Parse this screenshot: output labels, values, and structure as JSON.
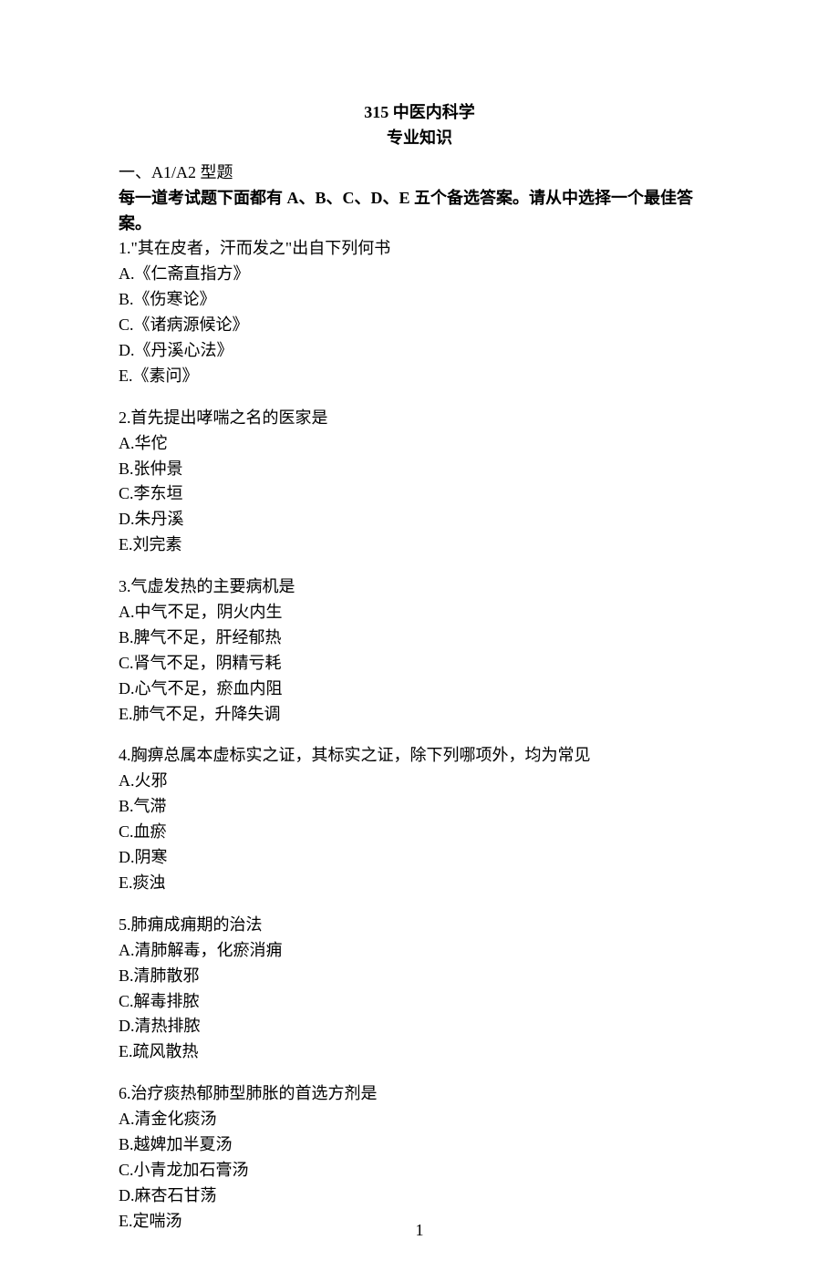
{
  "title": "315 中医内科学",
  "subtitle": "专业知识",
  "section_heading": "一、A1/A2 型题",
  "instructions": "每一道考试题下面都有 A、B、C、D、E 五个备选答案。请从中选择一个最佳答案。",
  "questions": [
    {
      "number": "1.",
      "stem": "\"其在皮者，汗而发之\"出自下列何书",
      "options": [
        "A.《仁斋直指方》",
        "B.《伤寒论》",
        "C.《诸病源候论》",
        "D.《丹溪心法》",
        "E.《素问》"
      ]
    },
    {
      "number": "2.",
      "stem": "首先提出哮喘之名的医家是",
      "options": [
        "A.华佗",
        "B.张仲景",
        "C.李东垣",
        "D.朱丹溪",
        "E.刘完素"
      ]
    },
    {
      "number": "3.",
      "stem": "气虚发热的主要病机是",
      "options": [
        "A.中气不足，阴火内生",
        "B.脾气不足，肝经郁热",
        "C.肾气不足，阴精亏耗",
        "D.心气不足，瘀血内阻",
        "E.肺气不足，升降失调"
      ]
    },
    {
      "number": "4.",
      "stem": "胸痹总属本虚标实之证，其标实之证，除下列哪项外，均为常见",
      "options": [
        "A.火邪",
        "B.气滞",
        "C.血瘀",
        "D.阴寒",
        "E.痰浊"
      ]
    },
    {
      "number": "5.",
      "stem": "肺痈成痈期的治法",
      "options": [
        "A.清肺解毒，化瘀消痈",
        "B.清肺散邪",
        "C.解毒排脓",
        "D.清热排脓",
        "E.疏风散热"
      ]
    },
    {
      "number": "6.",
      "stem": "治疗痰热郁肺型肺胀的首选方剂是",
      "options": [
        "A.清金化痰汤",
        "B.越婢加半夏汤",
        "C.小青龙加石膏汤",
        "D.麻杏石甘荡",
        "E.定喘汤"
      ]
    }
  ],
  "page_number": "1"
}
